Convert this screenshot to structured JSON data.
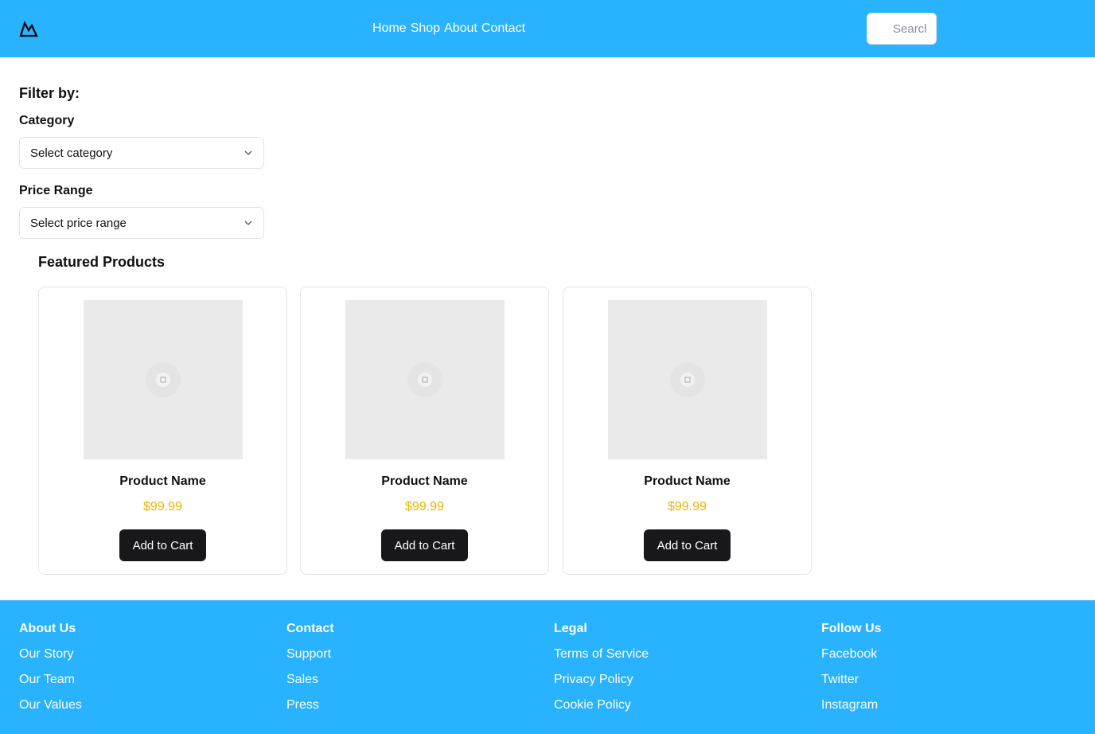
{
  "header": {
    "nav": [
      "Home",
      "Shop",
      "About",
      "Contact"
    ],
    "search_placeholder": "Search",
    "colors": {
      "background": "#29b2fd",
      "text": "#ffffff"
    }
  },
  "filter": {
    "title": "Filter by:",
    "category_label": "Category",
    "category_value": "Select category",
    "price_label": "Price Range",
    "price_value": "Select price range"
  },
  "featured": {
    "title": "Featured Products",
    "products": [
      {
        "name": "Product Name",
        "price": "$99.99",
        "button": "Add to Cart"
      },
      {
        "name": "Product Name",
        "price": "$99.99",
        "button": "Add to Cart"
      },
      {
        "name": "Product Name",
        "price": "$99.99",
        "button": "Add to Cart"
      }
    ],
    "colors": {
      "price": "#eab308",
      "button": "#18181b"
    }
  },
  "footer": {
    "columns": [
      {
        "heading": "About Us",
        "links": [
          "Our Story",
          "Our Team",
          "Our Values"
        ]
      },
      {
        "heading": "Contact",
        "links": [
          "Support",
          "Sales",
          "Press"
        ]
      },
      {
        "heading": "Legal",
        "links": [
          "Terms of Service",
          "Privacy Policy",
          "Cookie Policy"
        ]
      },
      {
        "heading": "Follow Us",
        "links": [
          "Facebook",
          "Twitter",
          "Instagram"
        ]
      }
    ]
  }
}
